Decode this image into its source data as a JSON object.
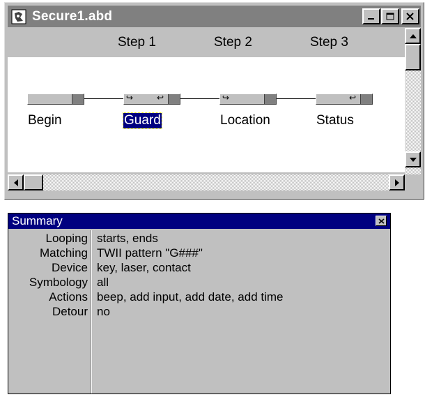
{
  "window": {
    "title": "Secure1.abd",
    "columns": [
      "Step 1",
      "Step 2",
      "Step 3"
    ],
    "steps": [
      {
        "name": "Begin"
      },
      {
        "name": "Guard",
        "selected": true
      },
      {
        "name": "Location"
      },
      {
        "name": "Status"
      }
    ]
  },
  "summary": {
    "title": "Summary",
    "rows": [
      {
        "label": "Looping",
        "value": "starts, ends"
      },
      {
        "label": "Matching",
        "value": "TWII pattern \"G###\""
      },
      {
        "label": "Device",
        "value": "key, laser, contact"
      },
      {
        "label": "Symbology",
        "value": "all"
      },
      {
        "label": "Actions",
        "value": "beep, add input, add date, add time"
      },
      {
        "label": "Detour",
        "value": "no"
      }
    ]
  },
  "colors": {
    "inactive_titlebar": "#808080",
    "active_titlebar": "#000080",
    "face": "#c0c0c0",
    "selection": "#000080"
  }
}
